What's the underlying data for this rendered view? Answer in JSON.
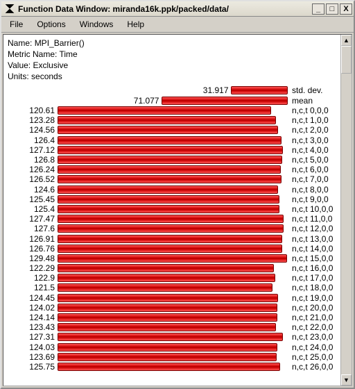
{
  "window": {
    "title": "Function Data Window: miranda16k.ppk/packed/data/",
    "buttons": {
      "min": "_",
      "max": "□",
      "close": "X"
    }
  },
  "menubar": [
    "File",
    "Options",
    "Windows",
    "Help"
  ],
  "meta": {
    "name_label": "Name:",
    "name": "MPI_Barrier()",
    "metric_label": "Metric Name:",
    "metric": "Time",
    "value_label": "Value:",
    "value": "Exclusive",
    "units_label": "Units:",
    "units": "seconds"
  },
  "chart_data": {
    "type": "bar",
    "orientation": "horizontal",
    "xlim": [
      0,
      130
    ],
    "summary": [
      {
        "label": "std. dev.",
        "value": 31.917
      },
      {
        "label": "mean",
        "value": 71.077
      }
    ],
    "series": [
      {
        "label": "n,c,t 0,0,0",
        "value": 120.61
      },
      {
        "label": "n,c,t 1,0,0",
        "value": 123.28
      },
      {
        "label": "n,c,t 2,0,0",
        "value": 124.56
      },
      {
        "label": "n,c,t 3,0,0",
        "value": 126.4
      },
      {
        "label": "n,c,t 4,0,0",
        "value": 127.12
      },
      {
        "label": "n,c,t 5,0,0",
        "value": 126.8
      },
      {
        "label": "n,c,t 6,0,0",
        "value": 126.24
      },
      {
        "label": "n,c,t 7,0,0",
        "value": 126.52
      },
      {
        "label": "n,c,t 8,0,0",
        "value": 124.6
      },
      {
        "label": "n,c,t 9,0,0",
        "value": 125.45
      },
      {
        "label": "n,c,t 10,0,0",
        "value": 125.4
      },
      {
        "label": "n,c,t 11,0,0",
        "value": 127.47
      },
      {
        "label": "n,c,t 12,0,0",
        "value": 127.6
      },
      {
        "label": "n,c,t 13,0,0",
        "value": 126.91
      },
      {
        "label": "n,c,t 14,0,0",
        "value": 126.76
      },
      {
        "label": "n,c,t 15,0,0",
        "value": 129.48
      },
      {
        "label": "n,c,t 16,0,0",
        "value": 122.29
      },
      {
        "label": "n,c,t 17,0,0",
        "value": 122.9
      },
      {
        "label": "n,c,t 18,0,0",
        "value": 121.5
      },
      {
        "label": "n,c,t 19,0,0",
        "value": 124.45
      },
      {
        "label": "n,c,t 20,0,0",
        "value": 124.02
      },
      {
        "label": "n,c,t 21,0,0",
        "value": 124.14
      },
      {
        "label": "n,c,t 22,0,0",
        "value": 123.43
      },
      {
        "label": "n,c,t 23,0,0",
        "value": 127.31
      },
      {
        "label": "n,c,t 24,0,0",
        "value": 124.03
      },
      {
        "label": "n,c,t 25,0,0",
        "value": 123.69
      },
      {
        "label": "n,c,t 26,0,0",
        "value": 125.75
      }
    ]
  }
}
